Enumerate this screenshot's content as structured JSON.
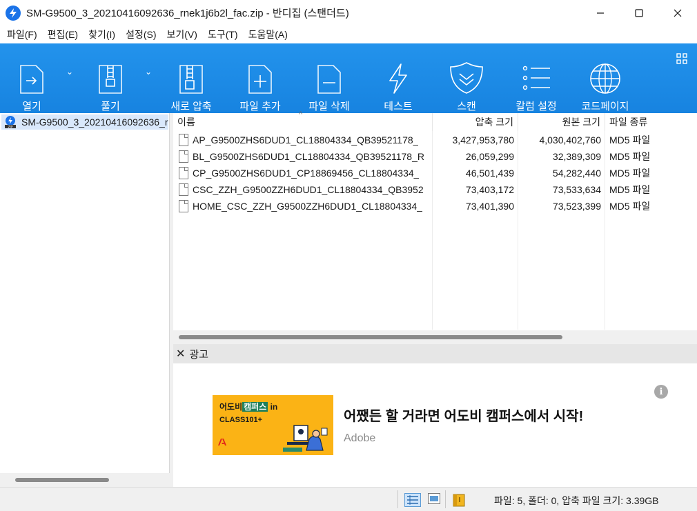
{
  "window": {
    "title": "SM-G9500_3_20210416092636_rnek1j6b2l_fac.zip - 반디집 (스탠더드)"
  },
  "menu": [
    "파일(F)",
    "편집(E)",
    "찾기(I)",
    "설정(S)",
    "보기(V)",
    "도구(T)",
    "도움말(A)"
  ],
  "toolbar": {
    "open": "열기",
    "extract": "풀기",
    "new_archive": "새로 압축",
    "add_files": "파일 추가",
    "delete_files": "파일 삭제",
    "test": "테스트",
    "scan": "스캔",
    "columns": "칼럼 설정",
    "codepage": "코드페이지"
  },
  "tree": {
    "root": "SM-G9500_3_20210416092636_r"
  },
  "columns": {
    "name": "이름",
    "packed": "압축 크기",
    "original": "원본 크기",
    "type": "파일 종류"
  },
  "files": [
    {
      "name": "AP_G9500ZHS6DUD1_CL18804334_QB39521178_",
      "packed": "3,427,953,780",
      "original": "4,030,402,760",
      "type": "MD5 파일"
    },
    {
      "name": "BL_G9500ZHS6DUD1_CL18804334_QB39521178_R",
      "packed": "26,059,299",
      "original": "32,389,309",
      "type": "MD5 파일"
    },
    {
      "name": "CP_G9500ZHS6DUD1_CP18869456_CL18804334_",
      "packed": "46,501,439",
      "original": "54,282,440",
      "type": "MD5 파일"
    },
    {
      "name": "CSC_ZZH_G9500ZZH6DUD1_CL18804334_QB3952",
      "packed": "73,403,172",
      "original": "73,533,634",
      "type": "MD5 파일"
    },
    {
      "name": "HOME_CSC_ZZH_G9500ZZH6DUD1_CL18804334_",
      "packed": "73,401,390",
      "original": "73,523,399",
      "type": "MD5 파일"
    }
  ],
  "ad": {
    "header": "광고",
    "banner_line1": "어도비",
    "banner_highlight": "캠퍼스",
    "banner_suffix": "in",
    "banner_line2": "CLASS101+",
    "title": "어쨌든 할 거라면 어도비 캠퍼스에서 시작!",
    "brand": "Adobe",
    "info_glyph": "i"
  },
  "status": {
    "text": "파일: 5, 폴더: 0, 압축 파일 크기: 3.39GB"
  },
  "colors": {
    "toolbar": "#1e8ae6",
    "selection": "#d9e8fb",
    "ad_banner": "#fbb315"
  }
}
